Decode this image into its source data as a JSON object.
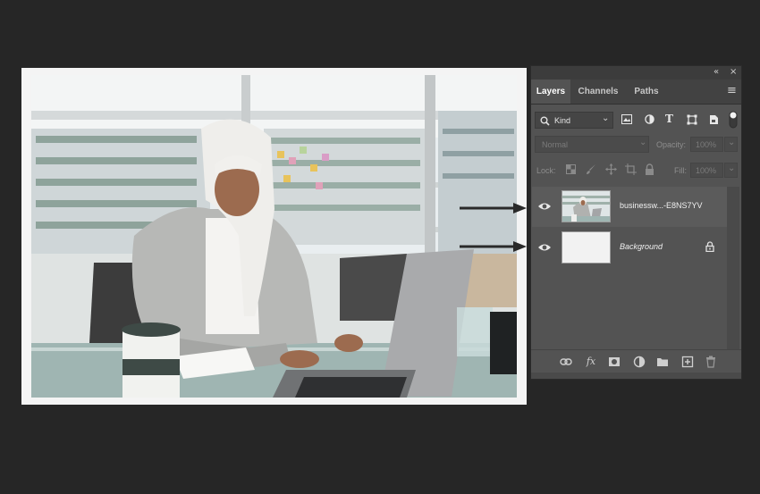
{
  "panel": {
    "collapse_icon": "«",
    "close_icon": "×",
    "tabs": [
      {
        "label": "Layers",
        "active": true
      },
      {
        "label": "Channels",
        "active": false
      },
      {
        "label": "Paths",
        "active": false
      }
    ],
    "menu_icon": "≡",
    "filter": {
      "label": "Kind",
      "chevron": "⌄"
    },
    "filter_icons": [
      "image-filter-icon",
      "adjustment-filter-icon",
      "type-filter-icon",
      "shape-filter-icon",
      "smart-object-filter-icon",
      "filter-toggle-icon"
    ],
    "blend_mode": "Normal",
    "opacity_label": "Opacity:",
    "opacity_value": "100%",
    "lock_label": "Lock:",
    "fill_label": "Fill:",
    "fill_value": "100%",
    "layers": [
      {
        "name": "businessw...-E8NS7YV",
        "visible": true,
        "italic": false,
        "locked": false
      },
      {
        "name": "Background",
        "visible": true,
        "italic": true,
        "locked": true
      }
    ],
    "bottom_icons": [
      "link-layers-icon",
      "fx-icon",
      "add-mask-icon",
      "adjustment-layer-icon",
      "new-group-icon",
      "new-layer-icon",
      "delete-layer-icon"
    ],
    "fx_label": "fx"
  },
  "colors": {
    "background": "#262626",
    "panel": "#535353",
    "arrow": "#2a2a2a"
  }
}
